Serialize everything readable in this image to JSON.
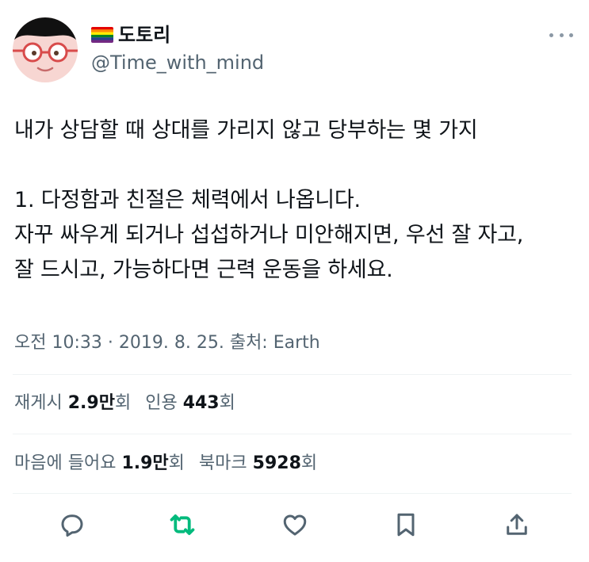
{
  "author": {
    "display_name": "도토리",
    "handle": "@Time_with_mind"
  },
  "tweet": {
    "lines": [
      "내가 상담할 때 상대를 가리지 않고 당부하는 몇 가지",
      "",
      "1. 다정함과 친절은 체력에서 나옵니다.",
      "자꾸 싸우게 되거나 섭섭하거나 미안해지면, 우선 잘 자고,",
      "잘 드시고, 가능하다면 근력 운동을 하세요."
    ]
  },
  "meta": {
    "time": "오전 10:33",
    "separator": "·",
    "date": "2019. 8. 25.",
    "source_label": "출처:",
    "source": "Earth"
  },
  "stats": {
    "retweets_label": "재게시",
    "retweets_num": "2.9만",
    "retweets_unit": "회",
    "quotes_label": "인용",
    "quotes_num": "443",
    "quotes_unit": "회",
    "likes_label": "마음에 들어요",
    "likes_num": "1.9만",
    "likes_unit": "회",
    "bookmarks_label": "북마크",
    "bookmarks_num": "5928",
    "bookmarks_unit": "회"
  },
  "actions": [
    {
      "icon": "reply-icon"
    },
    {
      "icon": "retweet-icon",
      "color": "#00ba7c"
    },
    {
      "icon": "like-icon"
    },
    {
      "icon": "bookmark-icon"
    },
    {
      "icon": "share-icon"
    }
  ],
  "colors": {
    "text_primary": "#0f1419",
    "text_secondary": "#536471",
    "retweet_active": "#00ba7c",
    "icon_gray": "#536471"
  }
}
